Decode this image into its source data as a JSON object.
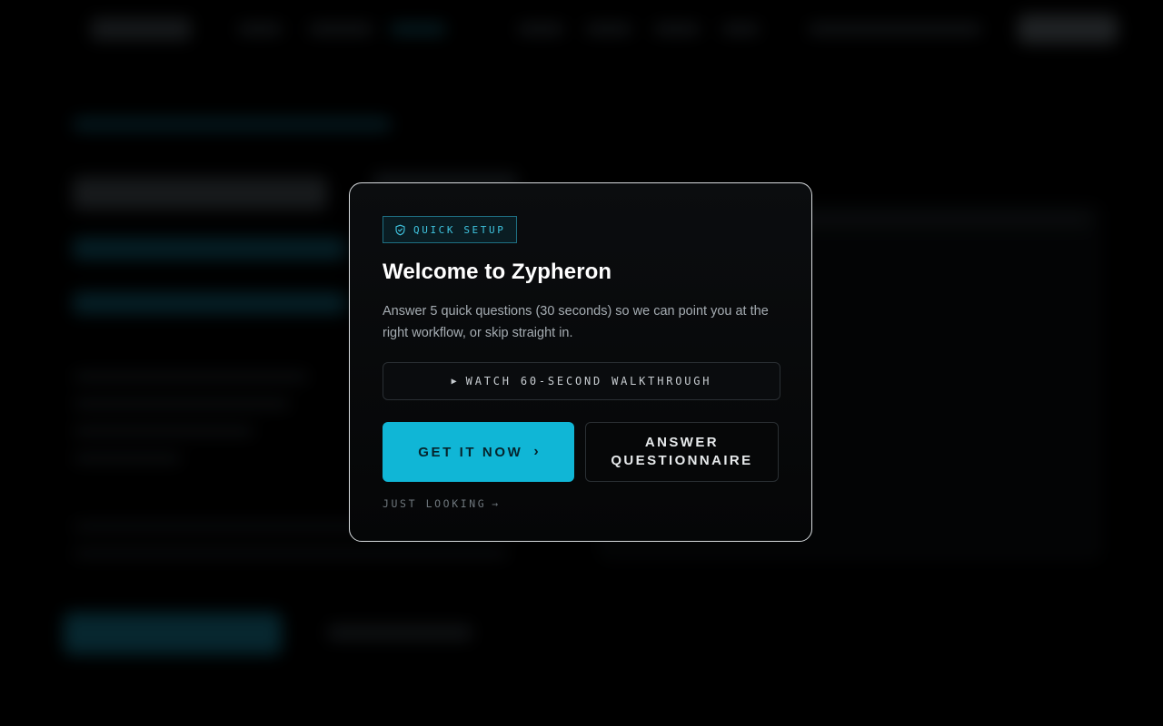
{
  "modal": {
    "badge": {
      "icon": "shield-check-icon",
      "label": "QUICK SETUP",
      "color": "#3fc3de"
    },
    "title": "Welcome to Zypheron",
    "description": "Answer 5 quick questions (30 seconds) so we can point you at the right workflow, or skip straight in.",
    "walkthrough": {
      "icon": "play-icon",
      "glyph": "▶",
      "label": "WATCH 60-SECOND WALKTHROUGH"
    },
    "primary_button": {
      "label": "GET IT NOW",
      "icon": "chevron-right-icon",
      "glyph": "›",
      "color": "#10b6d6"
    },
    "secondary_button": {
      "label": "ANSWER QUESTIONNAIRE"
    },
    "skip_link": {
      "label": "JUST LOOKING",
      "arrow": "→"
    }
  },
  "colors": {
    "background": "#000000",
    "accent": "#10b6d6",
    "modal_border": "#d8dcdf"
  }
}
